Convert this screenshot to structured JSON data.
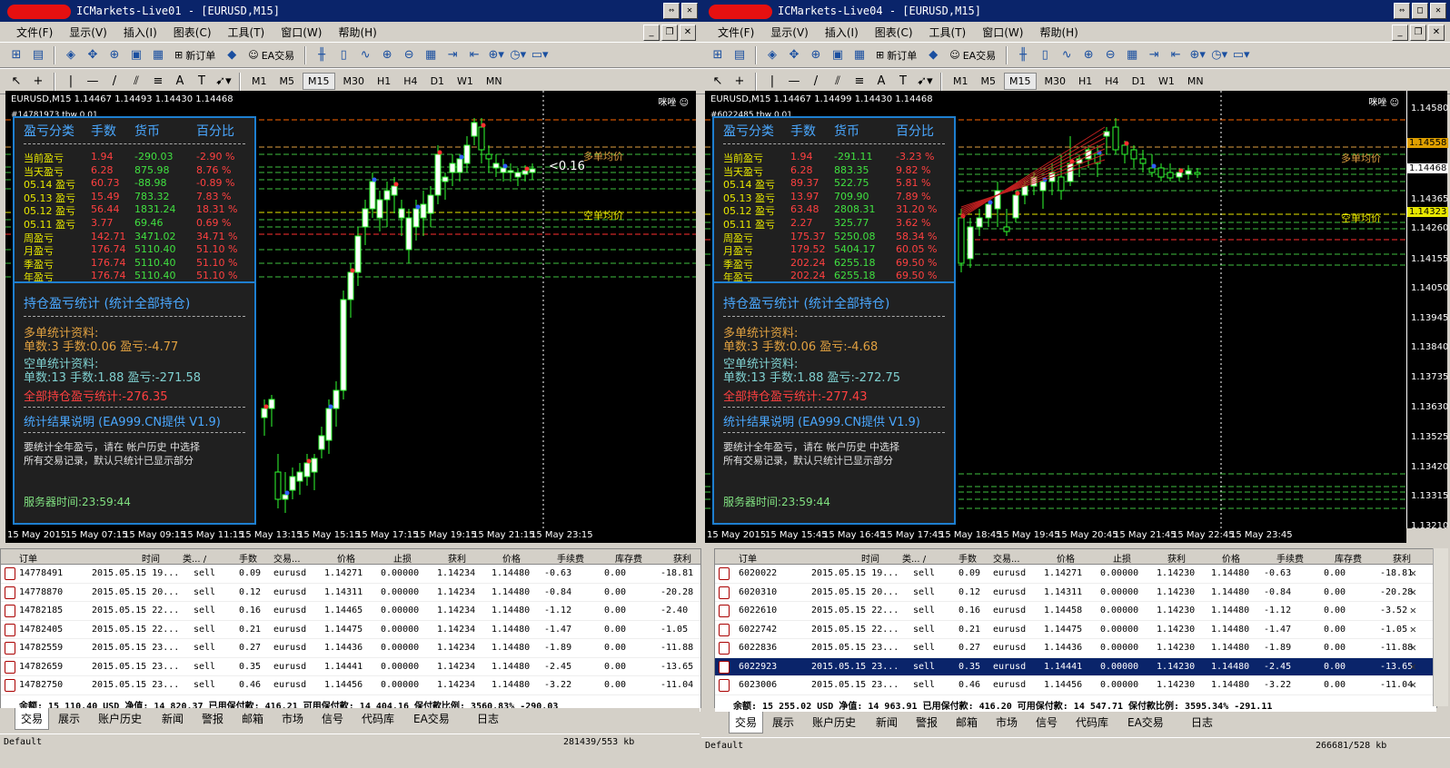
{
  "left": {
    "title": "ICMarkets-Live01 - [EURUSD,M15]",
    "symbol_line": "EURUSD,M15  1.14467 1.14493 1.14430 1.14468",
    "debug": "#14781973 tbw 0.01",
    "smile": "咪唑",
    "line_label_long": "多单均价",
    "line_label_short": "空单均价",
    "price_tag": "<0.16",
    "rows": [
      {
        "label": "当前盈亏",
        "lots": "1.94",
        "money": "-290.03",
        "pct": "-2.90 %"
      },
      {
        "label": "当天盈亏",
        "lots": "6.28",
        "money": "875.98",
        "pct": "8.76 %"
      },
      {
        "label": "05.14 盈亏",
        "lots": "60.73",
        "money": "-88.98",
        "pct": "-0.89 %"
      },
      {
        "label": "05.13 盈亏",
        "lots": "15.49",
        "money": "783.32",
        "pct": "7.83 %"
      },
      {
        "label": "05.12 盈亏",
        "lots": "56.44",
        "money": "1831.24",
        "pct": "18.31 %"
      },
      {
        "label": "05.11 盈亏",
        "lots": "3.77",
        "money": "69.46",
        "pct": "0.69 %"
      },
      {
        "label": "周盈亏",
        "lots": "142.71",
        "money": "3471.02",
        "pct": "34.71 %"
      },
      {
        "label": "月盈亏",
        "lots": "176.74",
        "money": "5110.40",
        "pct": "51.10 %"
      },
      {
        "label": "季盈亏",
        "lots": "176.74",
        "money": "5110.40",
        "pct": "51.10 %"
      },
      {
        "label": "年盈亏",
        "lots": "176.74",
        "money": "5110.40",
        "pct": "51.10 %"
      }
    ],
    "long_stats": "单数:3    手数:0.06    盈亏:-4.77",
    "short_stats": "单数:13    手数:1.88    盈亏:-271.58",
    "total_stats": "全部持仓盈亏统计:-276.35",
    "x_labels": [
      "15 May 2015",
      "15 May 07:15",
      "15 May 09:15",
      "15 May 11:15",
      "15 May 13:15",
      "15 May 15:15",
      "15 May 17:15",
      "15 May 19:15",
      "15 May 21:15",
      "15 May 23:15"
    ],
    "orders": [
      {
        "id": "14778491",
        "time": "2015.05.15 19...",
        "type": "sell",
        "lots": "0.09",
        "sym": "eurusd",
        "price": "1.14271",
        "sl": "0.00000",
        "tp": "1.14234",
        "cur": "1.14480",
        "comm": "-0.63",
        "swap": "0.00",
        "profit": "-18.81"
      },
      {
        "id": "14778870",
        "time": "2015.05.15 20...",
        "type": "sell",
        "lots": "0.12",
        "sym": "eurusd",
        "price": "1.14311",
        "sl": "0.00000",
        "tp": "1.14234",
        "cur": "1.14480",
        "comm": "-0.84",
        "swap": "0.00",
        "profit": "-20.28"
      },
      {
        "id": "14782185",
        "time": "2015.05.15 22...",
        "type": "sell",
        "lots": "0.16",
        "sym": "eurusd",
        "price": "1.14465",
        "sl": "0.00000",
        "tp": "1.14234",
        "cur": "1.14480",
        "comm": "-1.12",
        "swap": "0.00",
        "profit": "-2.40"
      },
      {
        "id": "14782405",
        "time": "2015.05.15 22...",
        "type": "sell",
        "lots": "0.21",
        "sym": "eurusd",
        "price": "1.14475",
        "sl": "0.00000",
        "tp": "1.14234",
        "cur": "1.14480",
        "comm": "-1.47",
        "swap": "0.00",
        "profit": "-1.05"
      },
      {
        "id": "14782559",
        "time": "2015.05.15 23...",
        "type": "sell",
        "lots": "0.27",
        "sym": "eurusd",
        "price": "1.14436",
        "sl": "0.00000",
        "tp": "1.14234",
        "cur": "1.14480",
        "comm": "-1.89",
        "swap": "0.00",
        "profit": "-11.88"
      },
      {
        "id": "14782659",
        "time": "2015.05.15 23...",
        "type": "sell",
        "lots": "0.35",
        "sym": "eurusd",
        "price": "1.14441",
        "sl": "0.00000",
        "tp": "1.14234",
        "cur": "1.14480",
        "comm": "-2.45",
        "swap": "0.00",
        "profit": "-13.65"
      },
      {
        "id": "14782750",
        "time": "2015.05.15 23...",
        "type": "sell",
        "lots": "0.46",
        "sym": "eurusd",
        "price": "1.14456",
        "sl": "0.00000",
        "tp": "1.14234",
        "cur": "1.14480",
        "comm": "-3.22",
        "swap": "0.00",
        "profit": "-11.04"
      }
    ],
    "footer": "余额: 15 110.40 USD  净值: 14 820.37  已用保付款: 416.21  可用保付款: 14 404.16  保付款比例: 3560.83%  -290.03",
    "status_right": "281439/553 kb"
  },
  "right": {
    "title": "ICMarkets-Live04 - [EURUSD,M15]",
    "symbol_line": "EURUSD,M15  1.14467 1.14499 1.14430 1.14468",
    "debug": "#6022485 tbw 0.01",
    "smile": "咪唑",
    "line_label_long": "多单均价",
    "line_label_short": "空单均价",
    "rows": [
      {
        "label": "当前盈亏",
        "lots": "1.94",
        "money": "-291.11",
        "pct": "-3.23 %"
      },
      {
        "label": "当天盈亏",
        "lots": "6.28",
        "money": "883.35",
        "pct": "9.82 %"
      },
      {
        "label": "05.14 盈亏",
        "lots": "89.37",
        "money": "522.75",
        "pct": "5.81 %"
      },
      {
        "label": "05.13 盈亏",
        "lots": "13.97",
        "money": "709.90",
        "pct": "7.89 %"
      },
      {
        "label": "05.12 盈亏",
        "lots": "63.48",
        "money": "2808.31",
        "pct": "31.20 %"
      },
      {
        "label": "05.11 盈亏",
        "lots": "2.27",
        "money": "325.77",
        "pct": "3.62 %"
      },
      {
        "label": "周盈亏",
        "lots": "175.37",
        "money": "5250.08",
        "pct": "58.34 %"
      },
      {
        "label": "月盈亏",
        "lots": "179.52",
        "money": "5404.17",
        "pct": "60.05 %"
      },
      {
        "label": "季盈亏",
        "lots": "202.24",
        "money": "6255.18",
        "pct": "69.50 %"
      },
      {
        "label": "年盈亏",
        "lots": "202.24",
        "money": "6255.18",
        "pct": "69.50 %"
      }
    ],
    "long_stats": "单数:3    手数:0.06    盈亏:-4.68",
    "short_stats": "单数:13    手数:1.88    盈亏:-272.75",
    "total_stats": "全部持仓盈亏统计:-277.43",
    "x_labels": [
      "15 May 2015",
      "15 May 15:45",
      "15 May 16:45",
      "15 May 17:45",
      "15 May 18:45",
      "15 May 19:45",
      "15 May 20:45",
      "15 May 21:45",
      "15 May 22:45",
      "15 May 23:45"
    ],
    "y_labels": [
      "1.14580",
      "1.14558",
      "1.14468",
      "1.14365",
      "1.14323",
      "1.14260",
      "1.14155",
      "1.14050",
      "1.13945",
      "1.13840",
      "1.13735",
      "1.13630",
      "1.13525",
      "1.13420",
      "1.13315",
      "1.13210"
    ],
    "orders": [
      {
        "id": "6020022",
        "time": "2015.05.15 19...",
        "type": "sell",
        "lots": "0.09",
        "sym": "eurusd",
        "price": "1.14271",
        "sl": "0.00000",
        "tp": "1.14230",
        "cur": "1.14480",
        "comm": "-0.63",
        "swap": "0.00",
        "profit": "-18.81"
      },
      {
        "id": "6020310",
        "time": "2015.05.15 20...",
        "type": "sell",
        "lots": "0.12",
        "sym": "eurusd",
        "price": "1.14311",
        "sl": "0.00000",
        "tp": "1.14230",
        "cur": "1.14480",
        "comm": "-0.84",
        "swap": "0.00",
        "profit": "-20.28"
      },
      {
        "id": "6022610",
        "time": "2015.05.15 22...",
        "type": "sell",
        "lots": "0.16",
        "sym": "eurusd",
        "price": "1.14458",
        "sl": "0.00000",
        "tp": "1.14230",
        "cur": "1.14480",
        "comm": "-1.12",
        "swap": "0.00",
        "profit": "-3.52"
      },
      {
        "id": "6022742",
        "time": "2015.05.15 22...",
        "type": "sell",
        "lots": "0.21",
        "sym": "eurusd",
        "price": "1.14475",
        "sl": "0.00000",
        "tp": "1.14230",
        "cur": "1.14480",
        "comm": "-1.47",
        "swap": "0.00",
        "profit": "-1.05"
      },
      {
        "id": "6022836",
        "time": "2015.05.15 23...",
        "type": "sell",
        "lots": "0.27",
        "sym": "eurusd",
        "price": "1.14436",
        "sl": "0.00000",
        "tp": "1.14230",
        "cur": "1.14480",
        "comm": "-1.89",
        "swap": "0.00",
        "profit": "-11.88"
      },
      {
        "id": "6022923",
        "time": "2015.05.15 23...",
        "type": "sell",
        "lots": "0.35",
        "sym": "eurusd",
        "price": "1.14441",
        "sl": "0.00000",
        "tp": "1.14230",
        "cur": "1.14480",
        "comm": "-2.45",
        "swap": "0.00",
        "profit": "-13.65"
      },
      {
        "id": "6023006",
        "time": "2015.05.15 23...",
        "type": "sell",
        "lots": "0.46",
        "sym": "eurusd",
        "price": "1.14456",
        "sl": "0.00000",
        "tp": "1.14230",
        "cur": "1.14480",
        "comm": "-3.22",
        "swap": "0.00",
        "profit": "-11.04"
      }
    ],
    "footer": "余额: 15 255.02 USD  净值: 14 963.91  已用保付款: 416.20  可用保付款: 14 547.71  保付款比例: 3595.34%  -291.11",
    "status_right": "266681/528 kb"
  },
  "common": {
    "menu": [
      "文件(F)",
      "显示(V)",
      "插入(I)",
      "图表(C)",
      "工具(T)",
      "窗口(W)",
      "帮助(H)"
    ],
    "new_order": "新订单",
    "ea_trade": "EA交易",
    "timeframes": [
      "M1",
      "M5",
      "M15",
      "M30",
      "H1",
      "H4",
      "D1",
      "W1",
      "MN"
    ],
    "panel_head": [
      "盈亏分类",
      "手数",
      "货币",
      "百分比"
    ],
    "pos_title": "持仓盈亏统计  (统计全部持仓)",
    "long_title": "多单统计资料:",
    "short_title": "空单统计资料:",
    "result_title": "统计结果说明  (EA999.CN提供 V1.9)",
    "note1": "要统计全年盈亏，请在 帐户历史 中选择",
    "note2": "所有交易记录，默认只统计已显示部分",
    "server_time": "服务器时间:23:59:44",
    "columns": [
      "订单",
      "时间",
      "类... /",
      "手数",
      "交易...",
      "价格",
      "止损",
      "获利",
      "价格",
      "手续费",
      "库存费",
      "获利"
    ],
    "tabs": [
      "交易",
      "展示",
      "账户历史",
      "新闻",
      "警报",
      "邮箱",
      "市场",
      "信号",
      "代码库",
      "EA交易",
      "日志"
    ],
    "status_left": "Default",
    "price_tags": [
      "1.14558",
      "1.14468",
      "1.14323"
    ]
  },
  "chart_data": [
    {
      "type": "candlestick",
      "title": "EURUSD,M15",
      "series": [
        {
          "name": "EURUSD",
          "values": []
        }
      ]
    },
    {
      "type": "candlestick",
      "title": "EURUSD,M15",
      "series": [
        {
          "name": "EURUSD",
          "values": []
        }
      ]
    }
  ]
}
